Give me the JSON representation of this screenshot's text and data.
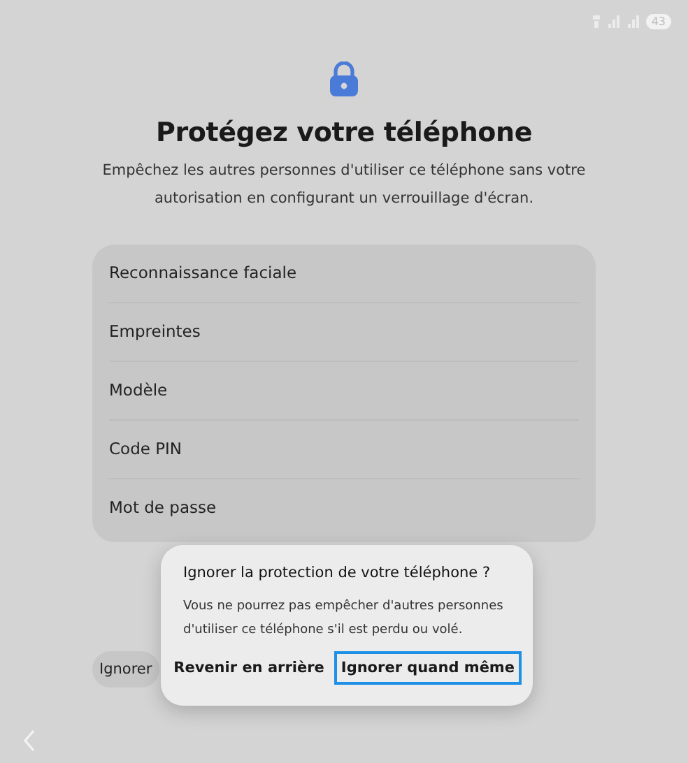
{
  "status_bar": {
    "battery": "43"
  },
  "title": "Protégez votre téléphone",
  "subtitle": "Empêchez les autres personnes d'utiliser ce téléphone sans votre autorisation en configurant un verrouillage d'écran.",
  "options": [
    {
      "label": "Reconnaissance faciale"
    },
    {
      "label": "Empreintes"
    },
    {
      "label": "Modèle"
    },
    {
      "label": "Code PIN"
    },
    {
      "label": "Mot de passe"
    }
  ],
  "skip_button": "Ignorer",
  "dialog": {
    "title": "Ignorer la protection de votre téléphone ?",
    "message": "Vous ne pourrez pas empêcher d'autres personnes d'utiliser ce téléphone s'il est perdu ou volé.",
    "buttons": [
      {
        "label": "Revenir en arrière",
        "focused": false
      },
      {
        "label": "Ignorer quand même",
        "focused": true
      }
    ]
  }
}
